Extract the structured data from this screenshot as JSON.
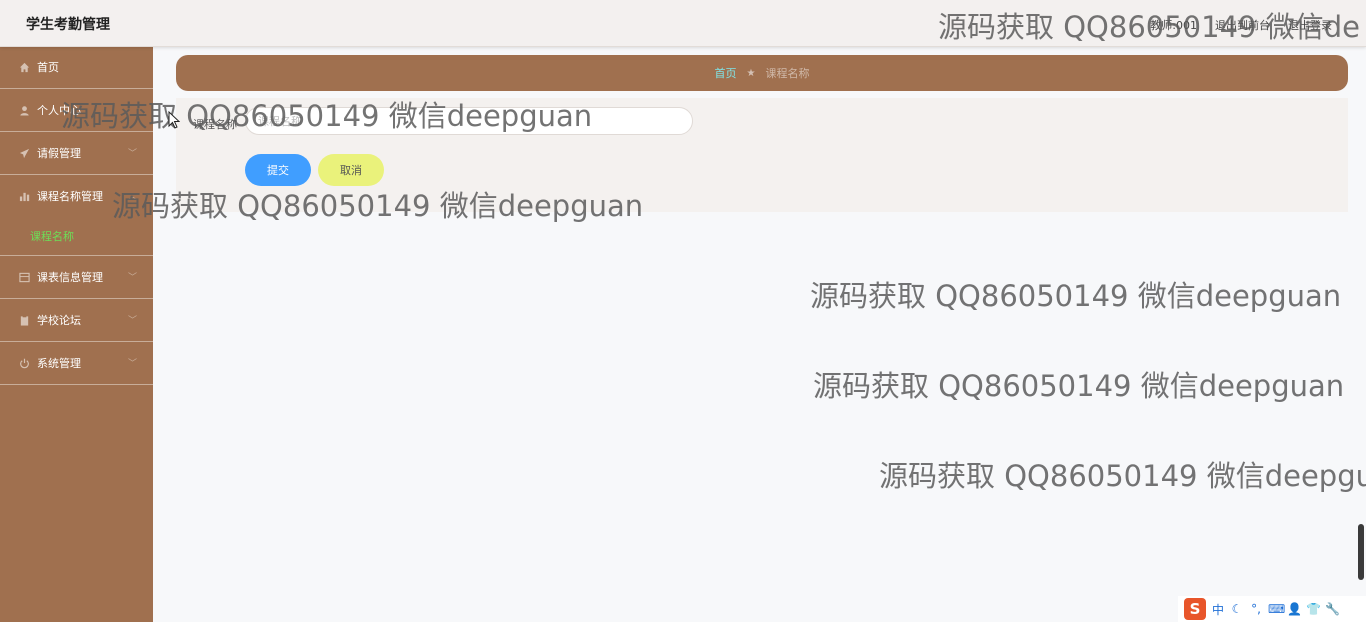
{
  "app": {
    "title": "学生考勤管理"
  },
  "header": {
    "user": "教师:001",
    "exit_front": "退出到前台",
    "logout": "退出登录"
  },
  "sidebar": {
    "items": [
      {
        "label": "首页",
        "icon": "home-icon"
      },
      {
        "label": "个人中心",
        "icon": "user-icon"
      },
      {
        "label": "请假管理",
        "icon": "send-icon"
      },
      {
        "label": "课程名称管理",
        "icon": "bar-chart-icon"
      },
      {
        "label": "课表信息管理",
        "icon": "table-icon"
      },
      {
        "label": "学校论坛",
        "icon": "clipboard-icon"
      },
      {
        "label": "系统管理",
        "icon": "power-icon"
      }
    ],
    "sub_item": "课程名称"
  },
  "breadcrumb": {
    "home": "首页",
    "current": "课程名称"
  },
  "form": {
    "field_label": "课程名称",
    "field_placeholder": "课程名称",
    "field_value": "",
    "submit_label": "提交",
    "cancel_label": "取消"
  },
  "watermark": {
    "text": "源码获取 QQ86050149 微信deepguan",
    "text_clipped_top": "源码获取 QQ86050149 微信de",
    "text_clipped_bottom": "源码获取 QQ86050149 微信deepgu"
  },
  "ime": {
    "logo": "S",
    "mode": "中",
    "items": [
      "☾",
      "°,",
      "⌨",
      "👤",
      "👕",
      "🔧"
    ]
  },
  "colors": {
    "sidebar_bg": "#a0704f",
    "breadcrumb_bg": "#a0704f",
    "active_submenu": "#6dde57",
    "breadcrumb_home": "#7fe3e6",
    "submit_bg": "#409eff",
    "cancel_bg": "#eaf27b"
  }
}
